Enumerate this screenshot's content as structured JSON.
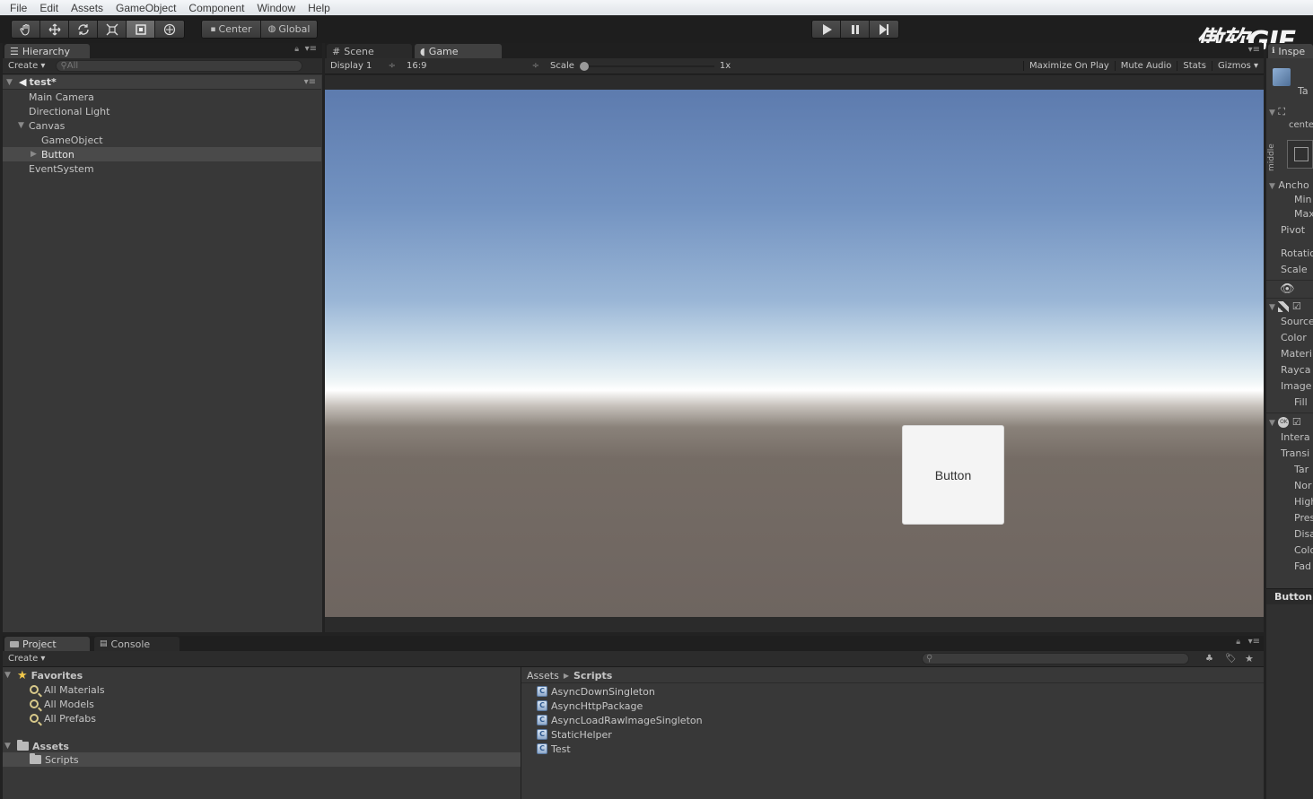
{
  "menu": [
    "File",
    "Edit",
    "Assets",
    "GameObject",
    "Component",
    "Window",
    "Help"
  ],
  "toolbar": {
    "pivot_center": "Center",
    "pivot_global": "Global",
    "play_icons": [
      "play-icon",
      "pause-icon",
      "step-icon"
    ],
    "watermark": "傲软GIF"
  },
  "hierarchy": {
    "tab": "Hierarchy",
    "create": "Create",
    "search_placeholder": "All",
    "scene": "test*",
    "items": [
      "Main Camera",
      "Directional Light",
      "Canvas",
      "GameObject",
      "Button",
      "EventSystem"
    ]
  },
  "game": {
    "scene_tab": "Scene",
    "game_tab": "Game",
    "display": "Display 1",
    "aspect": "16:9",
    "scale_label": "Scale",
    "scale_value": "1x",
    "maximize": "Maximize On Play",
    "mute": "Mute Audio",
    "stats": "Stats",
    "gizmos": "Gizmos",
    "button_text": "Button"
  },
  "inspector": {
    "tab": "Inspe",
    "tag": "Ta",
    "center": "cente",
    "middle": "middle",
    "rows": [
      "Ancho",
      "Min",
      "Max",
      "Pivot",
      "Rotatio",
      "Scale",
      "Source",
      "Color",
      "Materi",
      "Rayca",
      "Image",
      "Fill",
      "Intera",
      "Transi",
      "Tar",
      "Nor",
      "High",
      "Pres",
      "Disa",
      "Colo",
      "Fad",
      "Button"
    ]
  },
  "project": {
    "tab": "Project",
    "console_tab": "Console",
    "create": "Create",
    "favorites": "Favorites",
    "fav_items": [
      "All Materials",
      "All Models",
      "All Prefabs"
    ],
    "assets": "Assets",
    "folders": [
      "Scripts"
    ],
    "breadcrumb_root": "Assets",
    "breadcrumb_current": "Scripts",
    "files": [
      "AsyncDownSingleton",
      "AsyncHttpPackage",
      "AsyncLoadRawImageSingleton",
      "StaticHelper",
      "Test"
    ]
  }
}
